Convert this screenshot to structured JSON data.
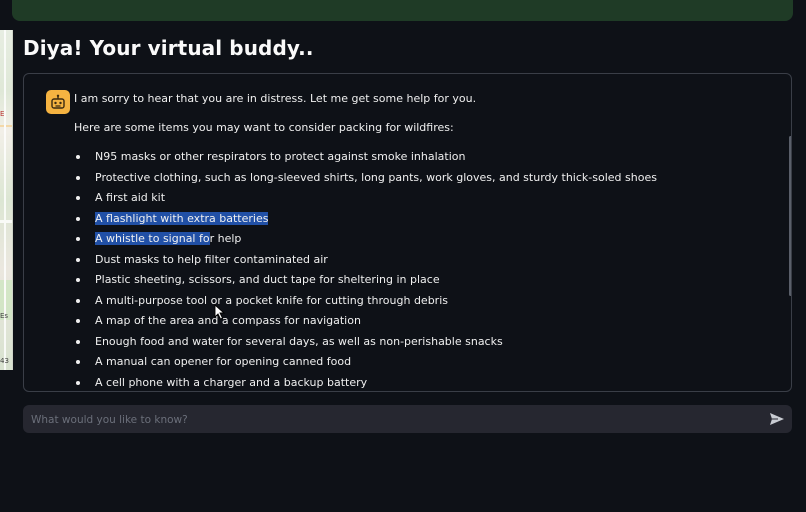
{
  "app": {
    "title": "Diya! Your virtual buddy.."
  },
  "chat": {
    "intro": "I am sorry to hear that you are in distress. Let me get some help for you.",
    "lead": "Here are some items you may want to consider packing for wildfires:",
    "items": [
      "N95 masks or other respirators to protect against smoke inhalation",
      "Protective clothing, such as long-sleeved shirts, long pants, work gloves, and sturdy thick-soled shoes",
      "A first aid kit",
      "A flashlight with extra batteries",
      "A whistle to signal for help",
      "Dust masks to help filter contaminated air",
      "Plastic sheeting, scissors, and duct tape for sheltering in place",
      "A multi-purpose tool or a pocket knife for cutting through debris",
      "A map of the area and a compass for navigation",
      "Enough food and water for several days, as well as non-perishable snacks",
      "A manual can opener for opening canned food",
      "A cell phone with a charger and a backup battery"
    ],
    "highlighted_item_4_part1": "A whistle to signal fo",
    "highlighted_item_4_part2": "r help"
  },
  "map": {
    "label_1": "E",
    "label_2": "Es",
    "label_3": "43"
  },
  "input": {
    "placeholder": "What would you like to know?"
  },
  "icons": {
    "avatar": "robot-icon",
    "send": "send-icon",
    "cursor": "mouse-pointer-icon"
  },
  "colors": {
    "background": "#0e1117",
    "topbar": "#1f3b26",
    "avatar": "#f5b341",
    "highlight": "#2150a6",
    "input_bg": "#262730"
  }
}
